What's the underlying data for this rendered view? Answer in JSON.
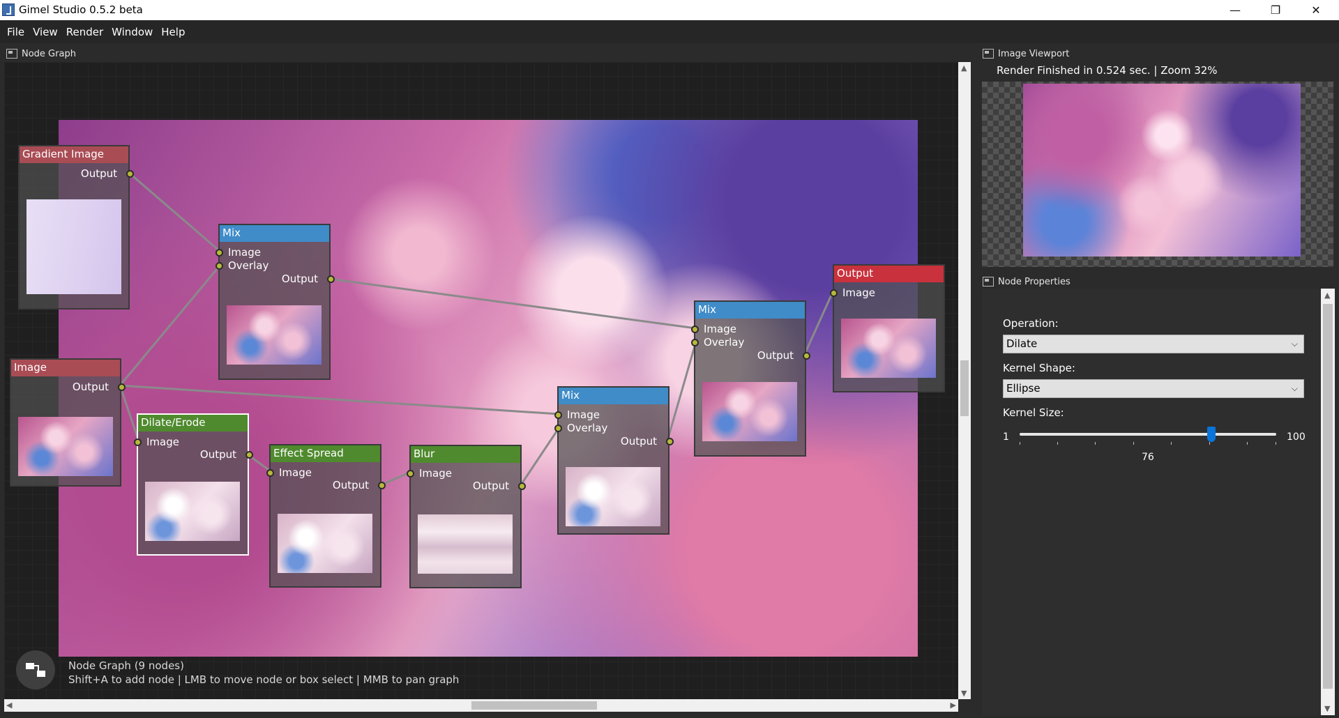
{
  "window": {
    "title": "Gimel Studio 0.5.2 beta",
    "controls": {
      "minimize": "—",
      "maximize": "❐",
      "close": "✕"
    }
  },
  "menu": [
    "File",
    "View",
    "Render",
    "Window",
    "Help"
  ],
  "node_graph": {
    "panel_title": "Node Graph",
    "status_title": "Node Graph (9 nodes)",
    "status_hint": "Shift+A to add node | LMB to move node or box select | MMB to pan graph",
    "nodes": {
      "gradient": {
        "title": "Gradient Image",
        "output": "Output"
      },
      "mix1": {
        "title": "Mix",
        "in1": "Image",
        "in2": "Overlay",
        "output": "Output"
      },
      "image": {
        "title": "Image",
        "output": "Output"
      },
      "dilate": {
        "title": "Dilate/Erode",
        "in1": "Image",
        "output": "Output"
      },
      "spread": {
        "title": "Effect Spread",
        "in1": "Image",
        "output": "Output"
      },
      "blur": {
        "title": "Blur",
        "in1": "Image",
        "output": "Output"
      },
      "mix2": {
        "title": "Mix",
        "in1": "Image",
        "in2": "Overlay",
        "output": "Output"
      },
      "mix3": {
        "title": "Mix",
        "in1": "Image",
        "in2": "Overlay",
        "output": "Output"
      },
      "output": {
        "title": "Output",
        "in1": "Image"
      }
    }
  },
  "viewport": {
    "panel_title": "Image Viewport",
    "status": "Render Finished in 0.524 sec. | Zoom 32%"
  },
  "properties": {
    "panel_title": "Node Properties",
    "operation_label": "Operation:",
    "operation_value": "Dilate",
    "kernel_shape_label": "Kernel Shape:",
    "kernel_shape_value": "Ellipse",
    "kernel_size_label": "Kernel Size:",
    "kernel_size_min": "1",
    "kernel_size_max": "100",
    "kernel_size_value": "76"
  },
  "colors": {
    "header_red": "#a94c54",
    "header_blue": "#3f8cc8",
    "header_green": "#4f8a2e",
    "header_output": "#c9323d",
    "socket": "#b8b83a",
    "accent": "#0a74d8"
  },
  "icons": [
    "app-icon",
    "node-graph-panel-icon",
    "viewport-panel-icon",
    "properties-panel-icon",
    "chevron-down-icon",
    "graph-logo-icon"
  ]
}
